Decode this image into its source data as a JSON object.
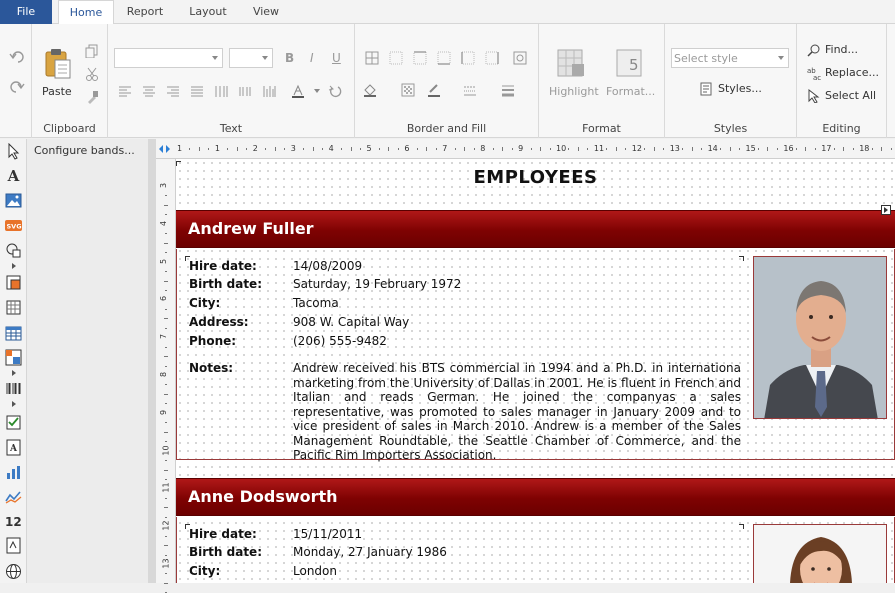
{
  "tabs": {
    "file": "File",
    "home": "Home",
    "report": "Report",
    "layout": "Layout",
    "view": "View"
  },
  "clipboard": {
    "paste": "Paste",
    "label": "Clipboard"
  },
  "text_group": {
    "label": "Text"
  },
  "border_fill": {
    "label": "Border and Fill"
  },
  "format": {
    "highlight": "Highlight",
    "format": "Format...",
    "label": "Format"
  },
  "styles": {
    "select_placeholder": "Select style",
    "styles_button": "Styles...",
    "label": "Styles"
  },
  "editing": {
    "find": "Find...",
    "replace": "Replace...",
    "select_all": "Select All",
    "label": "Editing"
  },
  "band_panel": {
    "configure": "Configure bands..."
  },
  "ruler": {
    "h": [
      "1",
      "1",
      "2",
      "3",
      "4",
      "5",
      "6",
      "7",
      "8",
      "9",
      "10",
      "11",
      "12",
      "13",
      "14",
      "15",
      "16",
      "17",
      "18"
    ],
    "v": [
      "3",
      "4",
      "5",
      "6",
      "7",
      "8",
      "9",
      "10",
      "11",
      "12",
      "13"
    ]
  },
  "report": {
    "title": "EMPLOYEES",
    "employees": [
      {
        "name": "Andrew Fuller",
        "hire_label": "Hire date:",
        "hire": "14/08/2009",
        "birth_label": "Birth date:",
        "birth": "Saturday, 19 February 1972",
        "city_label": "City:",
        "city": "Tacoma",
        "address_label": "Address:",
        "address": "908 W. Capital Way",
        "phone_label": "Phone:",
        "phone": "(206) 555-9482",
        "notes_label": "Notes:",
        "notes": "Andrew received his BTS commercial in 1994 and a Ph.D. in internationa marketing from the University of Dallas in 2001. He is fluent in French and Italian and reads German. He joined the companyas a sales representative, was promoted to sales manager in January 2009 and to vice president of sales in March 2010. Andrew is a member of the Sales Management Roundtable, the Seattle Chamber of Commerce, and the Pacific Rim Importers Association."
      },
      {
        "name": "Anne Dodsworth",
        "hire_label": "Hire date:",
        "hire": "15/11/2011",
        "birth_label": "Birth date:",
        "birth": "Monday, 27 January 1986",
        "city_label": "City:",
        "city": "London"
      }
    ]
  }
}
